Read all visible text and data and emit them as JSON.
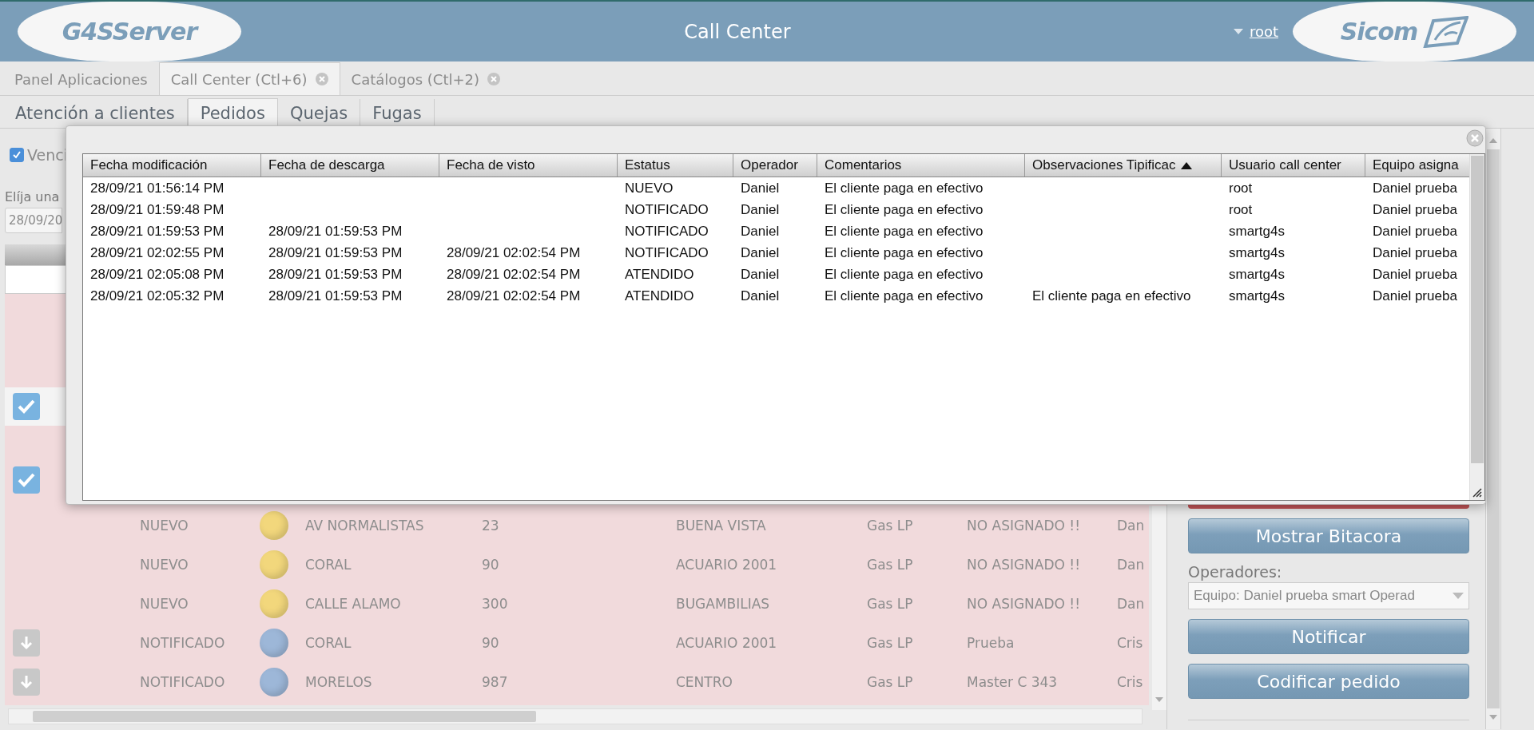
{
  "header": {
    "logo_left": "G4SServer",
    "title": "Call Center",
    "user": "root",
    "logo_right": "Sicom"
  },
  "app_tabs": [
    {
      "label": "Panel Aplicaciones",
      "selected": false,
      "closable": false
    },
    {
      "label": "Call Center (Ctl+6)",
      "selected": true,
      "closable": true
    },
    {
      "label": "Catálogos (Ctl+2)",
      "selected": false,
      "closable": true
    }
  ],
  "section_tabs": [
    {
      "label": "Atención a clientes",
      "selected": false
    },
    {
      "label": "Pedidos",
      "selected": true
    },
    {
      "label": "Quejas",
      "selected": false
    },
    {
      "label": "Fugas",
      "selected": false
    }
  ],
  "filters": {
    "overdue": {
      "label": "Venci",
      "checked": true
    },
    "date_label": "Elíja una",
    "date_value": "28/09/20"
  },
  "hidden_row_checks": [
    {
      "checked": true
    },
    {
      "checked": true
    }
  ],
  "orders": [
    {
      "kind": "new",
      "color": "#f2d77c",
      "cells": [
        "NUEVO",
        "AV NORMALISTAS",
        "23",
        "BUENA VISTA",
        "Gas LP",
        "NO ASIGNADO !!",
        "Dan"
      ]
    },
    {
      "kind": "new",
      "color": "#f2d77c",
      "cells": [
        "NUEVO",
        "CORAL",
        "90",
        "ACUARIO 2001",
        "Gas LP",
        "NO ASIGNADO !!",
        "Dan"
      ]
    },
    {
      "kind": "new",
      "color": "#f2d77c",
      "cells": [
        "NUEVO",
        "CALLE ALAMO",
        "300",
        "BUGAMBILIAS",
        "Gas LP",
        "NO ASIGNADO !!",
        "Dan"
      ]
    },
    {
      "kind": "notified",
      "color": "#9db7d8",
      "cells": [
        "NOTIFICADO",
        "CORAL",
        "90",
        "ACUARIO 2001",
        "Gas LP",
        "Prueba",
        "Cris"
      ]
    },
    {
      "kind": "notified",
      "color": "#9db7d8",
      "cells": [
        "NOTIFICADO",
        "MORELOS",
        "987",
        "CENTRO",
        "Gas LP",
        "Master C 343",
        "Cris"
      ]
    }
  ],
  "side_panel": {
    "buttons": [
      {
        "label": "Mostrar Bitacora"
      }
    ],
    "operators_label": "Operadores:",
    "operators_value": "Equipo: Daniel prueba smart Operad",
    "actions": [
      {
        "label": "Notificar"
      },
      {
        "label": "Codificar pedido"
      }
    ]
  },
  "log_dialog": {
    "columns": [
      {
        "label": "Fecha modificación",
        "sorted": false
      },
      {
        "label": "Fecha de descarga",
        "sorted": false
      },
      {
        "label": "Fecha de visto",
        "sorted": false
      },
      {
        "label": "Estatus",
        "sorted": false
      },
      {
        "label": "Operador",
        "sorted": false
      },
      {
        "label": "Comentarios",
        "sorted": false
      },
      {
        "label": "Observaciones Tipificac",
        "sorted": true
      },
      {
        "label": "Usuario call center",
        "sorted": false
      },
      {
        "label": "Equipo asigna",
        "sorted": false
      }
    ],
    "rows": [
      [
        "28/09/21 01:56:14 PM",
        "",
        "",
        "NUEVO",
        "Daniel",
        "El cliente paga en efectivo",
        "",
        "root",
        "Daniel prueba"
      ],
      [
        "28/09/21 01:59:48 PM",
        "",
        "",
        "NOTIFICADO",
        "Daniel",
        "El cliente paga en efectivo",
        "",
        "root",
        "Daniel prueba"
      ],
      [
        "28/09/21 01:59:53 PM",
        "28/09/21 01:59:53 PM",
        "",
        "NOTIFICADO",
        "Daniel",
        "El cliente paga en efectivo",
        "",
        "smartg4s",
        "Daniel prueba"
      ],
      [
        "28/09/21 02:02:55 PM",
        "28/09/21 01:59:53 PM",
        "28/09/21 02:02:54 PM",
        "NOTIFICADO",
        "Daniel",
        "El cliente paga en efectivo",
        "",
        "smartg4s",
        "Daniel prueba"
      ],
      [
        "28/09/21 02:05:08 PM",
        "28/09/21 01:59:53 PM",
        "28/09/21 02:02:54 PM",
        "ATENDIDO",
        "Daniel",
        "El cliente paga en efectivo",
        "",
        "smartg4s",
        "Daniel prueba"
      ],
      [
        "28/09/21 02:05:32 PM",
        "28/09/21 01:59:53 PM",
        "28/09/21 02:02:54 PM",
        "ATENDIDO",
        "Daniel",
        "El cliente paga en efectivo",
        "El cliente paga en efectivo",
        "smartg4s",
        "Daniel prueba"
      ]
    ]
  }
}
